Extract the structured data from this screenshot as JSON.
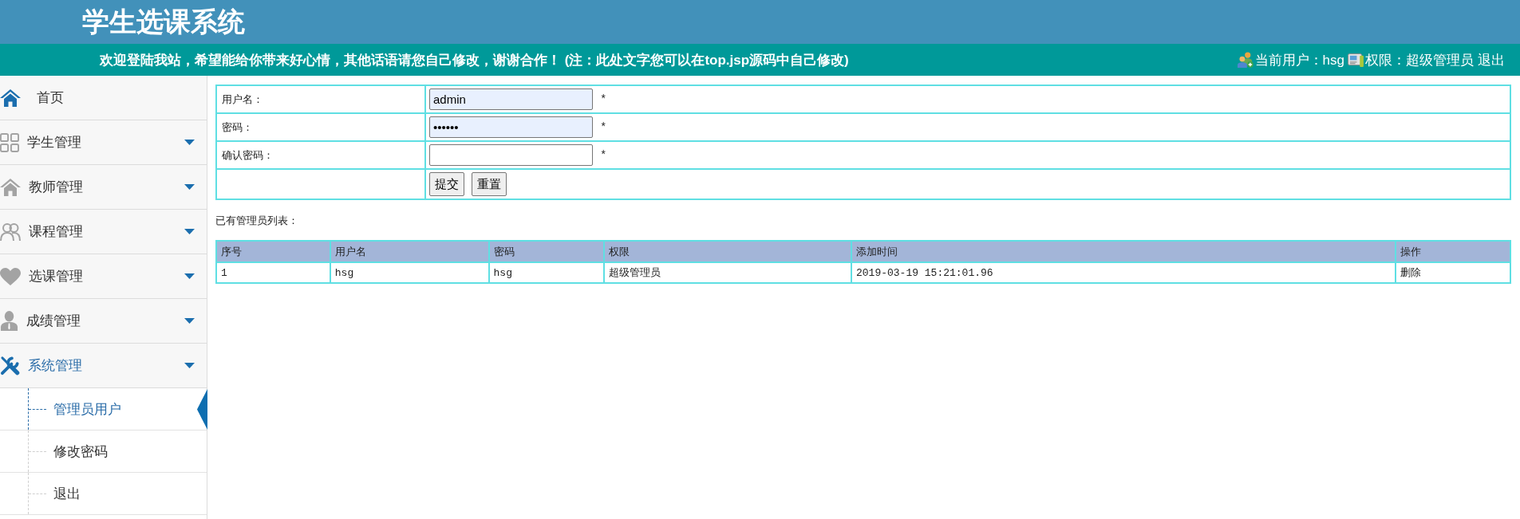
{
  "header": {
    "title": "学生选课系统",
    "welcome": "欢迎登陆我站，希望能给你带来好心情，其他话语请您自己修改，谢谢合作！ (注：此处文字您可以在top.jsp源码中自己修改)",
    "user": "当前用户：hsg",
    "role": "权限：超级管理员",
    "logout": "退出"
  },
  "sidebar": {
    "items": [
      {
        "label": "首页",
        "kind": "link",
        "expanded": false
      },
      {
        "label": "学生管理",
        "kind": "menu",
        "expanded": false
      },
      {
        "label": "教师管理",
        "kind": "menu",
        "expanded": false
      },
      {
        "label": "课程管理",
        "kind": "menu",
        "expanded": false
      },
      {
        "label": "选课管理",
        "kind": "menu",
        "expanded": false
      },
      {
        "label": "成绩管理",
        "kind": "menu",
        "expanded": false
      },
      {
        "label": "系统管理",
        "kind": "menu",
        "expanded": true,
        "children": [
          {
            "label": "管理员用户",
            "selected": true
          },
          {
            "label": "修改密码",
            "selected": false
          },
          {
            "label": "退出",
            "selected": false
          }
        ]
      }
    ]
  },
  "form": {
    "fields": [
      {
        "label": "用户名：",
        "kind": "text",
        "value": "admin",
        "autofilled": true,
        "mark": "*"
      },
      {
        "label": "密码：",
        "kind": "password",
        "value": "••••••",
        "autofilled": true,
        "mark": "*"
      },
      {
        "label": "确认密码：",
        "kind": "password",
        "autofilled": false,
        "mark": "*"
      }
    ],
    "buttons": [
      "提交",
      "重置"
    ]
  },
  "list_title": "已有管理员列表：",
  "table": {
    "columns": [
      "序号",
      "用户名",
      "密码",
      "权限",
      "添加时间",
      "操作"
    ],
    "rows": [
      [
        "1",
        "hsg",
        "hsg",
        "超级管理员",
        "2019-03-19 15:21:01.96",
        "删除"
      ]
    ]
  }
}
